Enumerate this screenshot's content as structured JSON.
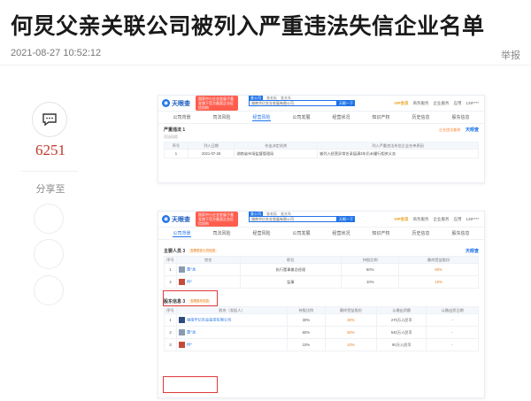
{
  "article": {
    "title": "何炅父亲关联公司被列入严重违法失信企业名单",
    "timestamp": "2021-08-27 10:52:12",
    "report_label": "举报"
  },
  "rail": {
    "comment_count": "6251",
    "share_label": "分享至"
  },
  "colors": {
    "accent": "#1f73e8",
    "comment_count": "#c0392b",
    "highlight": "#e03a3a"
  },
  "screenshot1": {
    "logo": "天眼查",
    "ad_text": "国家中小企业发展子基金旗下官方备案企业征信机构",
    "search_tabs": [
      "查公司",
      "查老板",
      "查关系"
    ],
    "search_value": "湖南华亿实业发展有限公司",
    "search_button": "天眼一下",
    "top_links": [
      "VIP会员",
      "商务服务",
      "企业服务",
      "应用",
      "139****"
    ],
    "nav": [
      "公司背景",
      "司法风险",
      "经营风险",
      "公司发展",
      "经营状况",
      "知识产权",
      "历史信息",
      "股东信息"
    ],
    "section": {
      "title": "严重违法 1",
      "sub": "司法风险"
    },
    "tyc_sub": "企业违法查询",
    "tyc_mark": "天眼查",
    "columns": [
      "序号",
      "列入日期",
      "作出决定机关",
      "列入严重违法失信企业名单原因"
    ],
    "rows": [
      [
        "1",
        "2021-07-28",
        "湖南省市场监督管理局",
        "被列入经营异常名录届满3年仍未履行相关义务"
      ]
    ]
  },
  "screenshot2": {
    "logo": "天眼查",
    "ad_text": "国家中小企业发展子基金旗下官方备案企业征信机构",
    "search_tabs": [
      "查公司",
      "查老板",
      "查关系"
    ],
    "search_value": "湖南华亿实业发展有限公司",
    "search_button": "天眼一下",
    "top_links": [
      "VIP会员",
      "商务服务",
      "企业服务",
      "应用",
      "139****"
    ],
    "nav": [
      "公司背景",
      "司法风险",
      "经营风险",
      "公司发展",
      "经营状况",
      "知识产权",
      "历史信息",
      "股东信息"
    ],
    "staff": {
      "title": "主要人员 3",
      "badge": "查看更多人员信息",
      "tyc_mark": "天眼查",
      "columns": [
        "序号",
        "姓名",
        "职位",
        "持股比例",
        "最终受益股份"
      ],
      "rows": [
        {
          "no": "1",
          "name": "董*龙",
          "role": "执行董事兼总经理",
          "ratio": "60%",
          "benefit": "60%"
        },
        {
          "no": "2",
          "name": "何*",
          "role": "监事",
          "ratio": "10%",
          "benefit": "10%"
        }
      ]
    },
    "holders": {
      "title": "股东信息 3",
      "badge": "查看股东信息",
      "columns": [
        "序号",
        "股东（发起人）",
        "持股比例",
        "最终受益股份",
        "认缴出资额",
        "认缴出资日期"
      ],
      "rows": [
        {
          "no": "1",
          "name": "湖南华亿实业投资有限公司",
          "ratio": "30%",
          "benefit": "30%",
          "amount": "270万人民币",
          "date": "-"
        },
        {
          "no": "2",
          "name": "董*龙",
          "ratio": "60%",
          "benefit": "60%",
          "amount": "540万人民币",
          "date": "-"
        },
        {
          "no": "3",
          "name": "何*",
          "ratio": "10%",
          "benefit": "10%",
          "amount": "90万人民币",
          "date": "-"
        }
      ]
    }
  }
}
